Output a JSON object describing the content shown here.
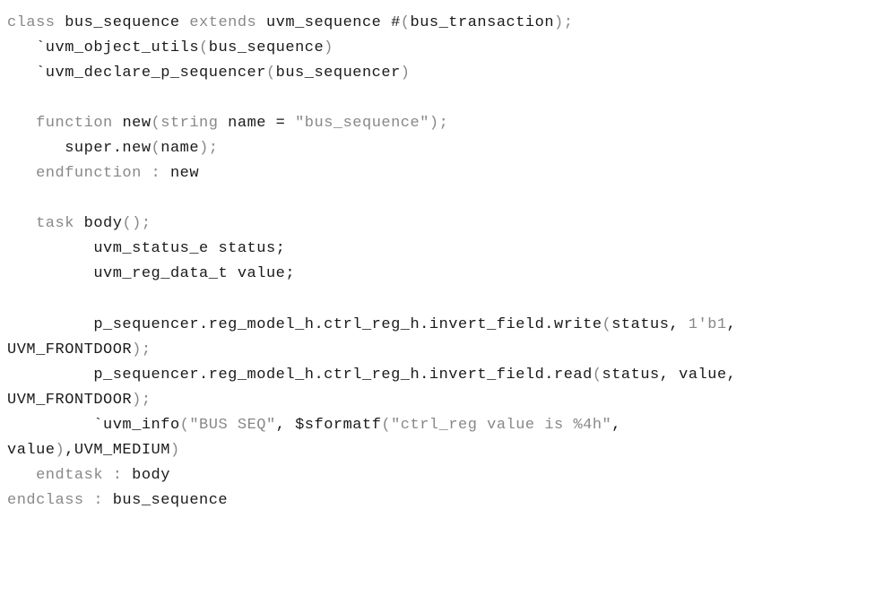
{
  "code": {
    "lines": [
      {
        "indent": 0,
        "tokens": [
          {
            "t": "class ",
            "c": "kw"
          },
          {
            "t": "bus_sequence",
            "c": "txt"
          },
          {
            "t": " extends ",
            "c": "kw"
          },
          {
            "t": "uvm_sequence #",
            "c": "txt"
          },
          {
            "t": "(",
            "c": "paren"
          },
          {
            "t": "bus_transaction",
            "c": "txt"
          },
          {
            "t": ");",
            "c": "paren"
          }
        ]
      },
      {
        "indent": 1,
        "tokens": [
          {
            "t": "`uvm_object_utils",
            "c": "txt"
          },
          {
            "t": "(",
            "c": "paren"
          },
          {
            "t": "bus_sequence",
            "c": "txt"
          },
          {
            "t": ")",
            "c": "paren"
          }
        ]
      },
      {
        "indent": 1,
        "tokens": [
          {
            "t": "`uvm_declare_p_sequencer",
            "c": "txt"
          },
          {
            "t": "(",
            "c": "paren"
          },
          {
            "t": "bus_sequencer",
            "c": "txt"
          },
          {
            "t": ")",
            "c": "paren"
          }
        ]
      },
      {
        "indent": 0,
        "tokens": []
      },
      {
        "indent": 1,
        "tokens": [
          {
            "t": "function ",
            "c": "kw"
          },
          {
            "t": "new",
            "c": "txt"
          },
          {
            "t": "(",
            "c": "paren"
          },
          {
            "t": "string ",
            "c": "kw"
          },
          {
            "t": "name = ",
            "c": "txt"
          },
          {
            "t": "\"bus_sequence\"",
            "c": "kw"
          },
          {
            "t": ");",
            "c": "paren"
          }
        ]
      },
      {
        "indent": 2,
        "tokens": [
          {
            "t": "super.new",
            "c": "txt"
          },
          {
            "t": "(",
            "c": "paren"
          },
          {
            "t": "name",
            "c": "txt"
          },
          {
            "t": ");",
            "c": "paren"
          }
        ]
      },
      {
        "indent": 1,
        "tokens": [
          {
            "t": "endfunction : ",
            "c": "kw"
          },
          {
            "t": "new",
            "c": "txt"
          }
        ]
      },
      {
        "indent": 0,
        "tokens": []
      },
      {
        "indent": 1,
        "tokens": [
          {
            "t": "task ",
            "c": "kw"
          },
          {
            "t": "body",
            "c": "txt"
          },
          {
            "t": "();",
            "c": "paren"
          }
        ]
      },
      {
        "indent": 3,
        "tokens": [
          {
            "t": "uvm_status_e status;",
            "c": "txt"
          }
        ]
      },
      {
        "indent": 3,
        "tokens": [
          {
            "t": "uvm_reg_data_t value;",
            "c": "txt"
          }
        ]
      },
      {
        "indent": 0,
        "tokens": []
      },
      {
        "indent": 3,
        "tokens": [
          {
            "t": "p_sequencer.reg_model_h.ctrl_reg_h.invert_field.write",
            "c": "txt"
          },
          {
            "t": "(",
            "c": "paren"
          },
          {
            "t": "status, ",
            "c": "txt"
          },
          {
            "t": "1'b1",
            "c": "num"
          },
          {
            "t": ", ",
            "c": "txt"
          }
        ]
      },
      {
        "indent": 0,
        "tokens": [
          {
            "t": "UVM_FRONTDOOR",
            "c": "txt"
          },
          {
            "t": ");",
            "c": "paren"
          }
        ]
      },
      {
        "indent": 3,
        "tokens": [
          {
            "t": "p_sequencer.reg_model_h.ctrl_reg_h.invert_field.read",
            "c": "txt"
          },
          {
            "t": "(",
            "c": "paren"
          },
          {
            "t": "status, value, ",
            "c": "txt"
          }
        ]
      },
      {
        "indent": 0,
        "tokens": [
          {
            "t": "UVM_FRONTDOOR",
            "c": "txt"
          },
          {
            "t": ");",
            "c": "paren"
          }
        ]
      },
      {
        "indent": 3,
        "tokens": [
          {
            "t": "`uvm_info",
            "c": "txt"
          },
          {
            "t": "(",
            "c": "paren"
          },
          {
            "t": "\"BUS SEQ\"",
            "c": "kw"
          },
          {
            "t": ", $sformatf",
            "c": "txt"
          },
          {
            "t": "(",
            "c": "paren"
          },
          {
            "t": "\"ctrl_reg value is %4h\"",
            "c": "kw"
          },
          {
            "t": ", ",
            "c": "txt"
          }
        ]
      },
      {
        "indent": 0,
        "tokens": [
          {
            "t": "value",
            "c": "txt"
          },
          {
            "t": ")",
            "c": "paren"
          },
          {
            "t": ",UVM_MEDIUM",
            "c": "txt"
          },
          {
            "t": ")",
            "c": "paren"
          }
        ]
      },
      {
        "indent": 1,
        "tokens": [
          {
            "t": "endtask : ",
            "c": "kw"
          },
          {
            "t": "body",
            "c": "txt"
          }
        ]
      },
      {
        "indent": 0,
        "tokens": [
          {
            "t": "endclass : ",
            "c": "kw"
          },
          {
            "t": "bus_sequence",
            "c": "txt"
          }
        ]
      }
    ]
  }
}
